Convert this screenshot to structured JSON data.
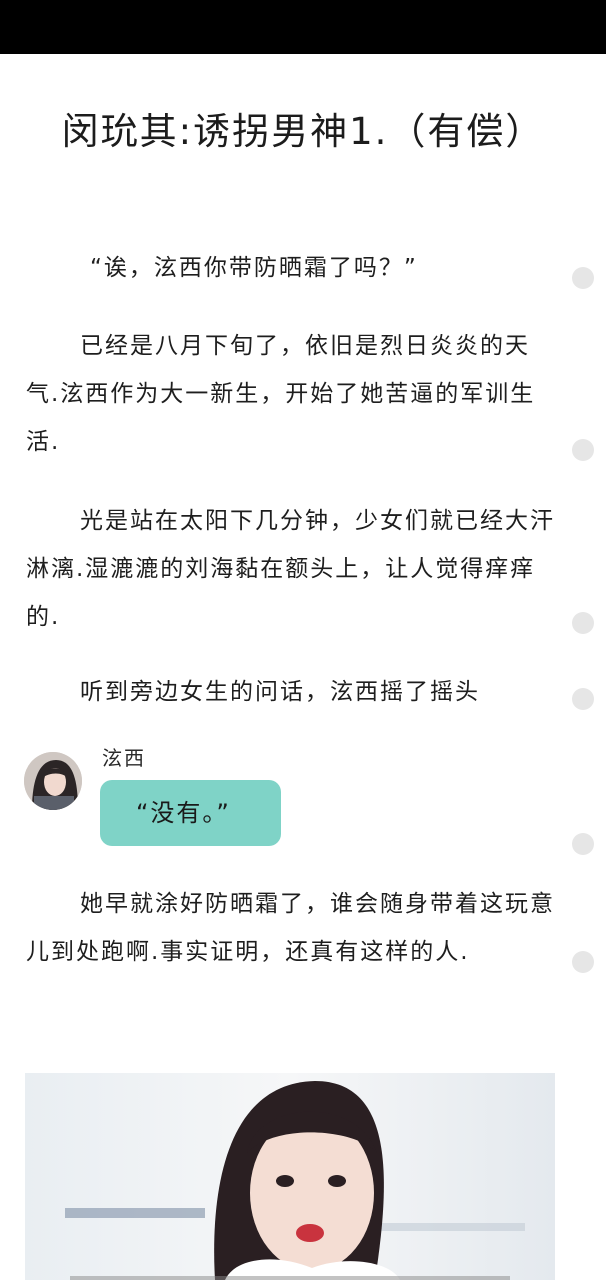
{
  "article": {
    "title": "闵玧其:诱拐男神1.（有偿）",
    "quote": "“诶，泫西你带防晒霜了吗？”",
    "para1": "已经是八月下旬了，依旧是烈日炎炎的天气.泫西作为大一新生，开始了她苦逼的军训生活.",
    "para2": "光是站在太阳下几分钟，少女们就已经大汗淋漓.湿漉漉的刘海黏在额头上，让人觉得痒痒的.",
    "para3": "听到旁边女生的问话，泫西摇了摇头",
    "para4": "她早就涂好防晒霜了，谁会随身带着这玩意儿到处跑啊.事实证明，还真有这样的人."
  },
  "chat": {
    "speaker": "泫西",
    "message": "“没有。”",
    "bubble_color": "#7fd3c7"
  },
  "side_dots": 7
}
